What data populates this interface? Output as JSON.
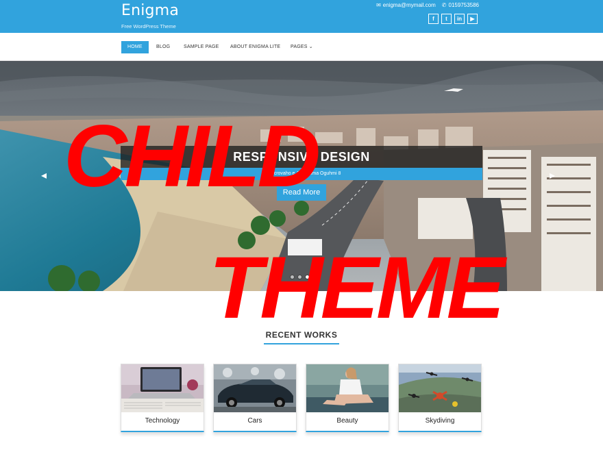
{
  "site": {
    "title": "Enigma",
    "tagline": "Free WordPress Theme"
  },
  "contact": {
    "email": "enigma@mymail.com",
    "phone": "0159753586"
  },
  "socials": [
    {
      "name": "facebook-icon",
      "glyph": "f"
    },
    {
      "name": "twitter-icon",
      "glyph": "t"
    },
    {
      "name": "linkedin-icon",
      "glyph": "in"
    },
    {
      "name": "youtube-icon",
      "glyph": "▶"
    }
  ],
  "nav": {
    "home": "HOME",
    "blog": "BLOG",
    "sample": "SAMPLE PAGE",
    "about": "ABOUT ENIGMA LITE",
    "pages": "PAGES"
  },
  "slider": {
    "caption_title": "RESPONSIVE DESIGN",
    "caption_sub": "Jmaecrovaho e Jahenoma Oguhmi 8",
    "read_more": "Read More",
    "dots": 3,
    "active_dot": 2
  },
  "watermark": {
    "line1": "CHILD",
    "line2": "THEME",
    "color": "#ff0000"
  },
  "recent_works": {
    "title": "RECENT WORKS",
    "items": [
      "Technology",
      "Cars",
      "Beauty",
      "Skydiving"
    ]
  },
  "colors": {
    "accent": "#31a3dd"
  }
}
